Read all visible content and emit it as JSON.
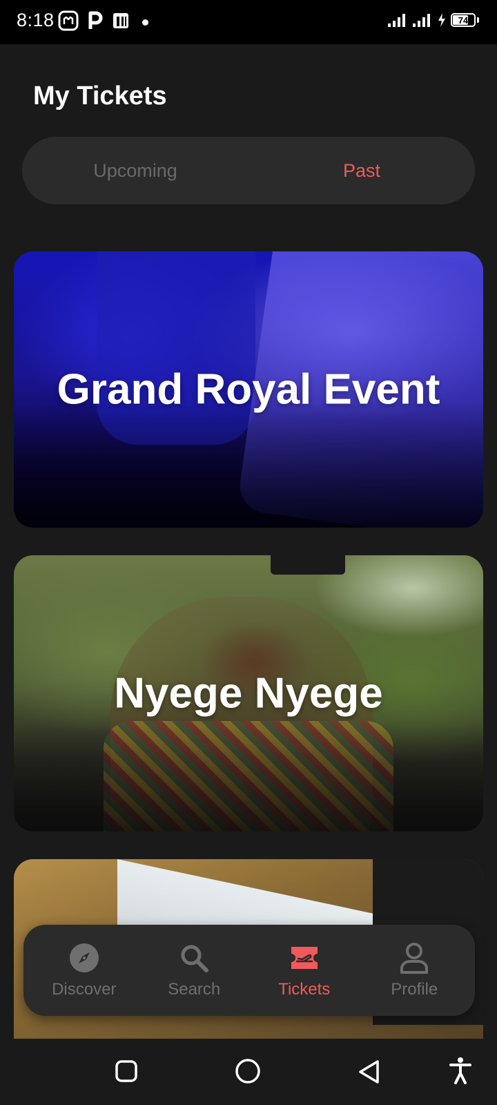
{
  "status_bar": {
    "time": "8:18",
    "battery_level": "74",
    "battery_fraction": 0.74
  },
  "page": {
    "title": "My Tickets"
  },
  "tabs": {
    "upcoming": "Upcoming",
    "past": "Past",
    "selected": "past"
  },
  "events": [
    {
      "title": "Grand Royal Event"
    },
    {
      "title": "Nyege Nyege"
    },
    {
      "title": ""
    }
  ],
  "bottom_nav": {
    "items": [
      {
        "label": "Discover",
        "icon": "compass-icon"
      },
      {
        "label": "Search",
        "icon": "search-icon"
      },
      {
        "label": "Tickets",
        "icon": "ticket-icon"
      },
      {
        "label": "Profile",
        "icon": "profile-icon"
      }
    ],
    "active": "Tickets"
  },
  "colors": {
    "accent": "#f05a5a",
    "background": "#1a1a1a",
    "surface": "#2b2b2b",
    "inactive": "#6f6f6f"
  }
}
